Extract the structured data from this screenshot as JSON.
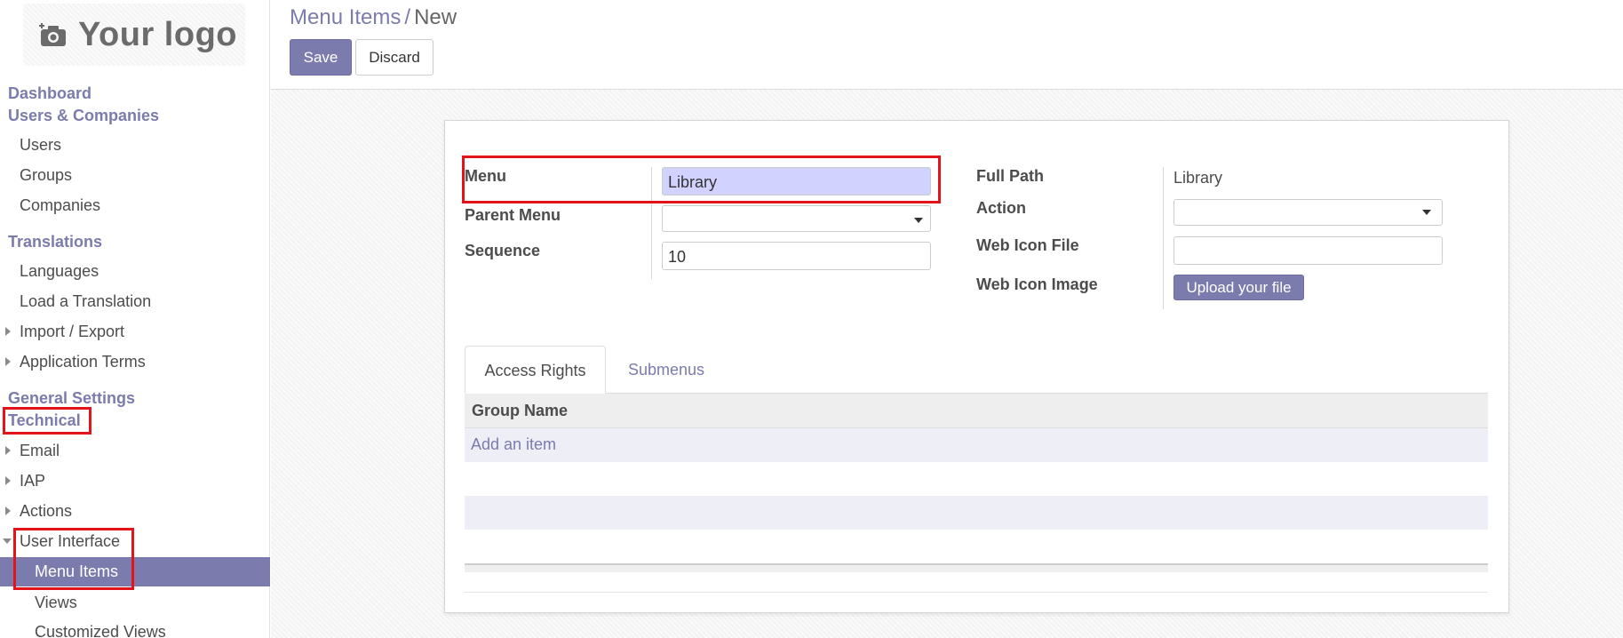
{
  "logo": {
    "text": "Your logo",
    "icon": "camera-icon"
  },
  "sidebar": {
    "dashboard": "Dashboard",
    "users_companies": "Users & Companies",
    "users": "Users",
    "groups": "Groups",
    "companies": "Companies",
    "translations": "Translations",
    "languages": "Languages",
    "load_translation": "Load a Translation",
    "import_export": "Import / Export",
    "application_terms": "Application Terms",
    "general_settings": "General Settings",
    "technical": "Technical",
    "email": "Email",
    "iap": "IAP",
    "actions": "Actions",
    "user_interface": "User Interface",
    "menu_items": "Menu Items",
    "views": "Views",
    "customized_views": "Customized Views"
  },
  "header": {
    "breadcrumb_parent": "Menu Items",
    "breadcrumb_sep": "/",
    "breadcrumb_current": "New",
    "save_label": "Save",
    "discard_label": "Discard"
  },
  "form": {
    "menu_label": "Menu",
    "menu_value": "Library",
    "parent_menu_label": "Parent Menu",
    "parent_menu_value": "",
    "sequence_label": "Sequence",
    "sequence_value": "10",
    "full_path_label": "Full Path",
    "full_path_value": "Library",
    "action_label": "Action",
    "action_value": "",
    "web_icon_file_label": "Web Icon File",
    "web_icon_file_value": "",
    "web_icon_image_label": "Web Icon Image",
    "upload_label": "Upload your file"
  },
  "tabs": [
    {
      "label": "Access Rights",
      "active": true
    },
    {
      "label": "Submenus",
      "active": false
    }
  ],
  "table": {
    "header": "Group Name",
    "add_item": "Add an item"
  },
  "colors": {
    "accent": "#7c7bad",
    "required_field": "#d2d2ff",
    "highlight": "#e3131b"
  }
}
